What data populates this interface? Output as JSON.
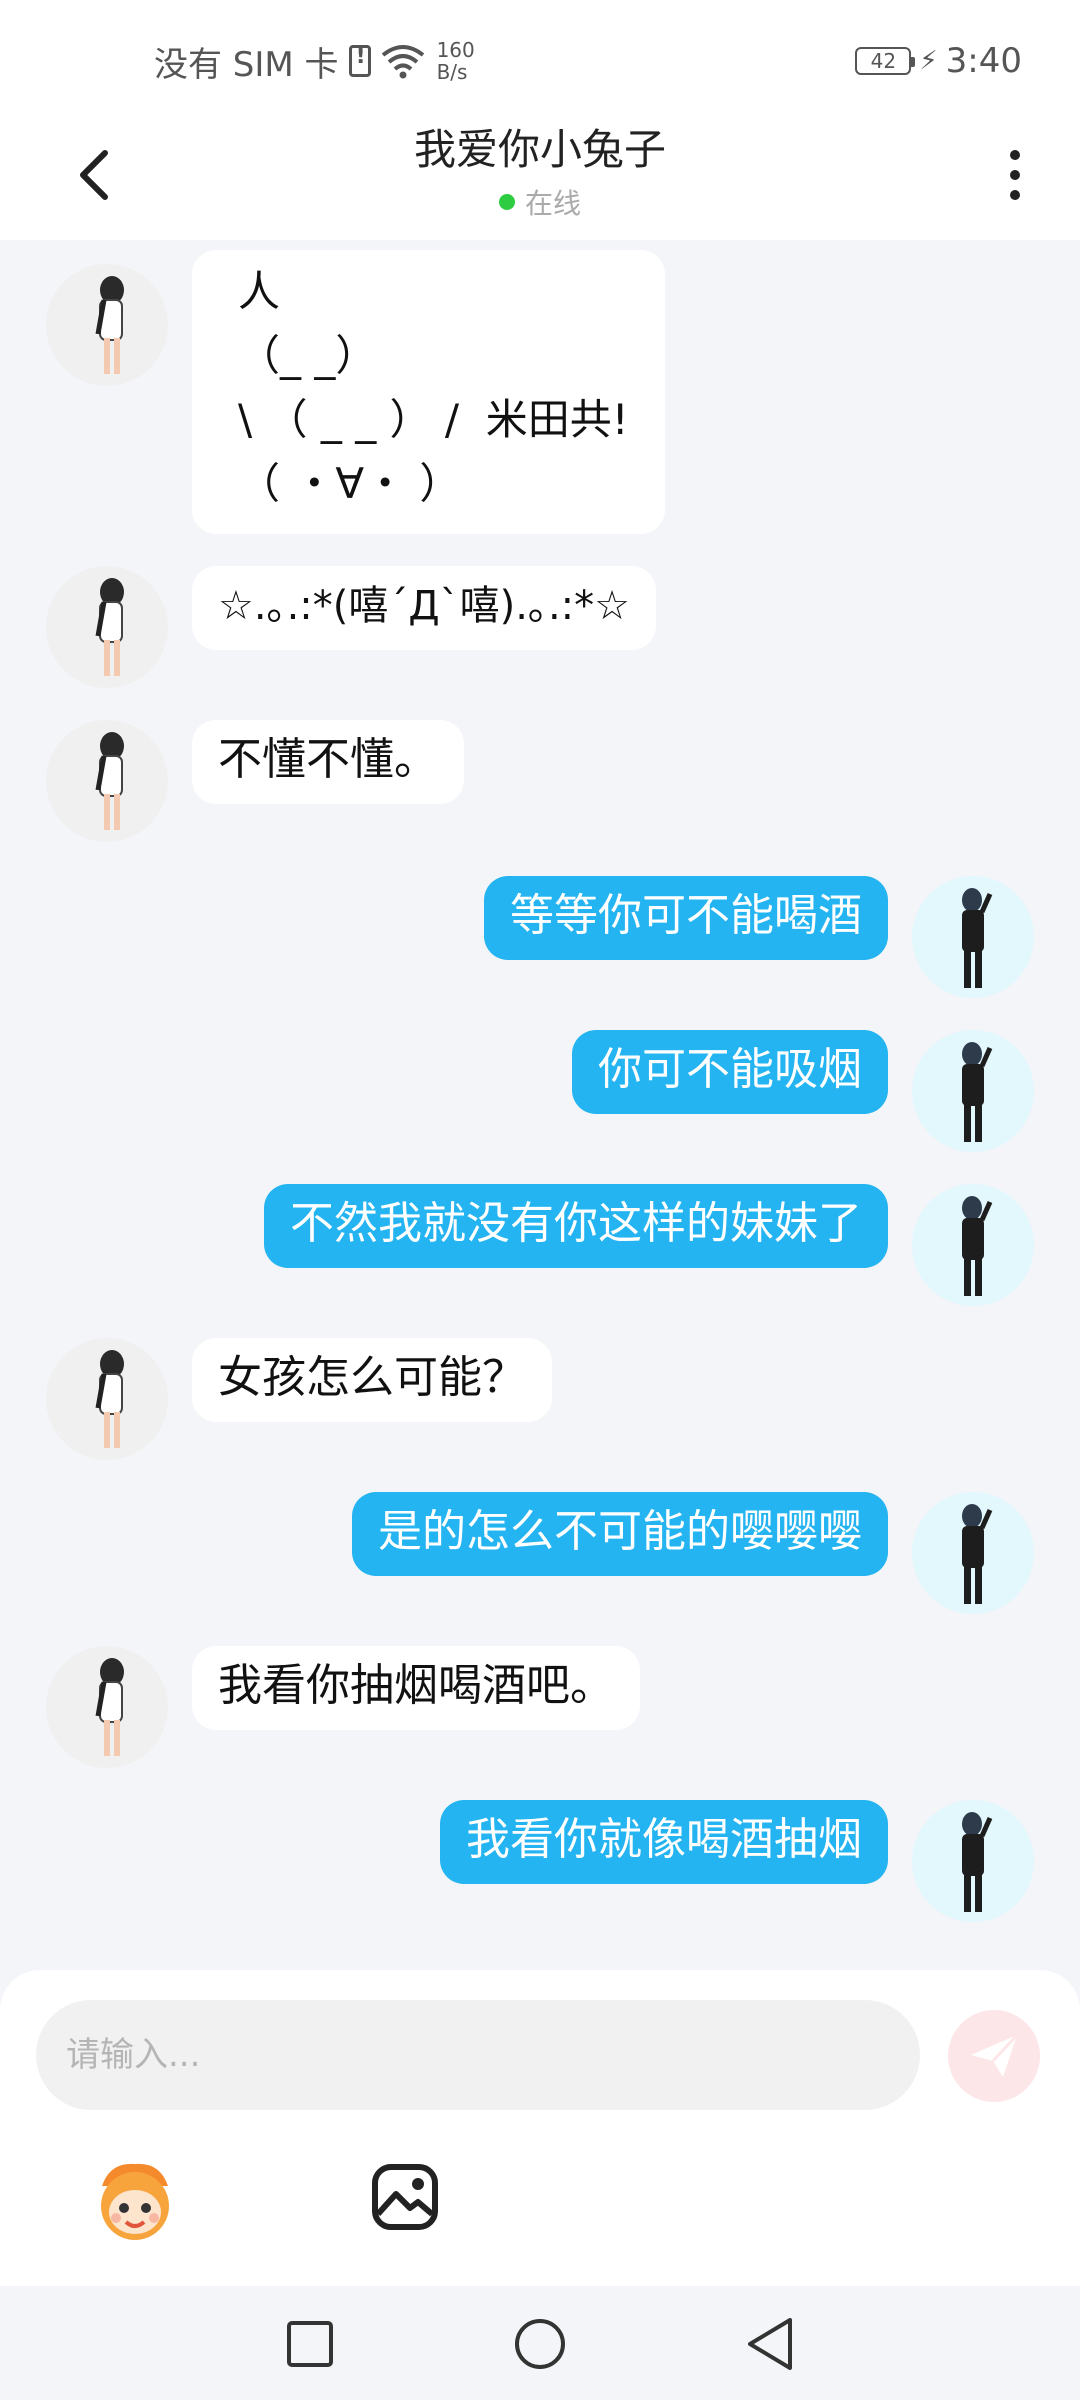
{
  "status_bar": {
    "carrier": "没有 SIM 卡",
    "speed_value": "160",
    "speed_unit": "B/s",
    "battery": "42",
    "time": "3:40"
  },
  "header": {
    "title": "我爱你小兔子",
    "status": "在线"
  },
  "messages": [
    {
      "side": "left",
      "text": "人\n（_ _）\n\\ （ _ _ ） /  米田共!\n（ ・∀・ ）"
    },
    {
      "side": "left",
      "text": "☆.｡.:*(嘻´Д`嘻).｡.:*☆"
    },
    {
      "side": "left",
      "text": "不懂不懂。"
    },
    {
      "side": "right",
      "text": "等等你可不能喝酒"
    },
    {
      "side": "right",
      "text": "你可不能吸烟"
    },
    {
      "side": "right",
      "text": "不然我就没有你这样的妹妹了"
    },
    {
      "side": "left",
      "text": "女孩怎么可能？"
    },
    {
      "side": "right",
      "text": "是的怎么不可能的嘤嘤嘤"
    },
    {
      "side": "left",
      "text": "我看你抽烟喝酒吧。"
    },
    {
      "side": "right",
      "text": "我看你就像喝酒抽烟"
    }
  ],
  "input": {
    "placeholder": "请输入...",
    "value": ""
  },
  "icons": {
    "back": "back-arrow-icon",
    "more": "more-vertical-icon",
    "send": "send-icon",
    "emoji": "emoji-mascot-icon",
    "image": "image-icon",
    "nav_recent": "square-icon",
    "nav_home": "circle-icon",
    "nav_back": "triangle-back-icon"
  },
  "colors": {
    "outgoing_bubble": "#23b4f1",
    "incoming_bubble": "#ffffff",
    "background": "#f3f5f8",
    "online": "#2ecc40",
    "send_button": "#fde6e7"
  }
}
